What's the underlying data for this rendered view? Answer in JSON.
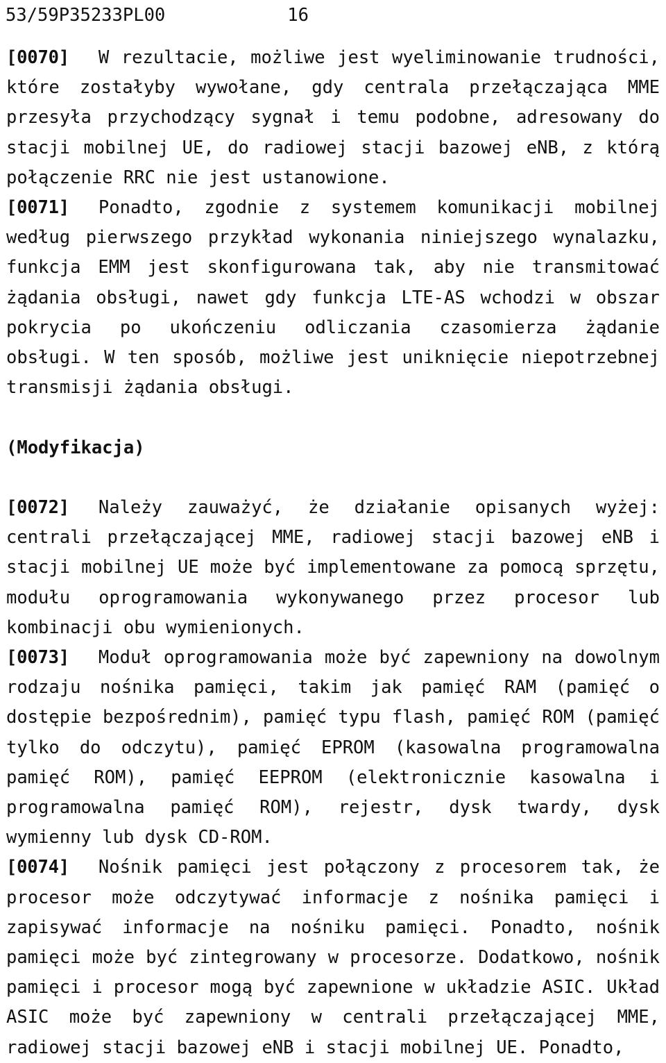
{
  "document": {
    "language": "pl",
    "background_color": "#ffffff",
    "text_color": "#111111"
  },
  "header": {
    "doc_id": "53/59P35233PL00",
    "page_number": "16"
  },
  "body": {
    "blocks": [
      {
        "type": "paragraph",
        "marker": "[0070]",
        "text": "W rezultacie, możliwe jest wyeliminowanie trudności, które zostałyby wywołane, gdy centrala przełączająca MME przesyła przychodzący sygnał i temu podobne, adresowany do stacji mobilnej UE, do radiowej stacji bazowej eNB, z którą połączenie RRC nie jest ustanowione."
      },
      {
        "type": "paragraph",
        "marker": "[0071]",
        "text": "Ponadto, zgodnie z systemem komunikacji mobilnej według pierwszego przykład wykonania niniejszego wynalazku, funkcja EMM jest skonfigurowana tak, aby nie transmitować żądania obsługi, nawet gdy funkcja LTE-AS wchodzi w obszar pokrycia po ukończeniu odliczania czasomierza żądanie obsługi. W ten sposób, możliwe jest uniknięcie niepotrzebnej transmisji żądania obsługi."
      },
      {
        "type": "blank"
      },
      {
        "type": "heading",
        "text": "(Modyfikacja)"
      },
      {
        "type": "blank"
      },
      {
        "type": "paragraph",
        "marker": "[0072]",
        "text": "Należy zauważyć, że działanie opisanych wyżej: centrali przełączającej MME, radiowej stacji bazowej eNB i stacji mobilnej UE może być implementowane za pomocą sprzętu, modułu oprogramowania wykonywanego przez procesor lub kombinacji obu wymienionych."
      },
      {
        "type": "paragraph",
        "marker": "[0073]",
        "text": "Moduł oprogramowania może być zapewniony na dowolnym rodzaju nośnika pamięci, takim jak pamięć RAM (pamięć o dostępie bezpośrednim), pamięć typu flash, pamięć ROM (pamięć tylko do odczytu), pamięć EPROM (kasowalna programowalna pamięć ROM), pamięć EEPROM (elektronicznie kasowalna i programowalna pamięć ROM), rejestr, dysk twardy, dysk wymienny lub dysk CD-ROM."
      },
      {
        "type": "paragraph",
        "marker": "[0074]",
        "text": "Nośnik pamięci jest połączony z procesorem tak, że procesor może odczytywać informacje z nośnika pamięci i zapisywać informacje na nośniku pamięci. Ponadto, nośnik pamięci może być zintegrowany w procesorze. Dodatkowo, nośnik pamięci i procesor mogą być zapewnione w układzie ASIC. Układ ASIC może być zapewniony w centrali przełączającej MME, radiowej stacji bazowej eNB i stacji mobilnej UE. Ponadto,"
      }
    ]
  }
}
